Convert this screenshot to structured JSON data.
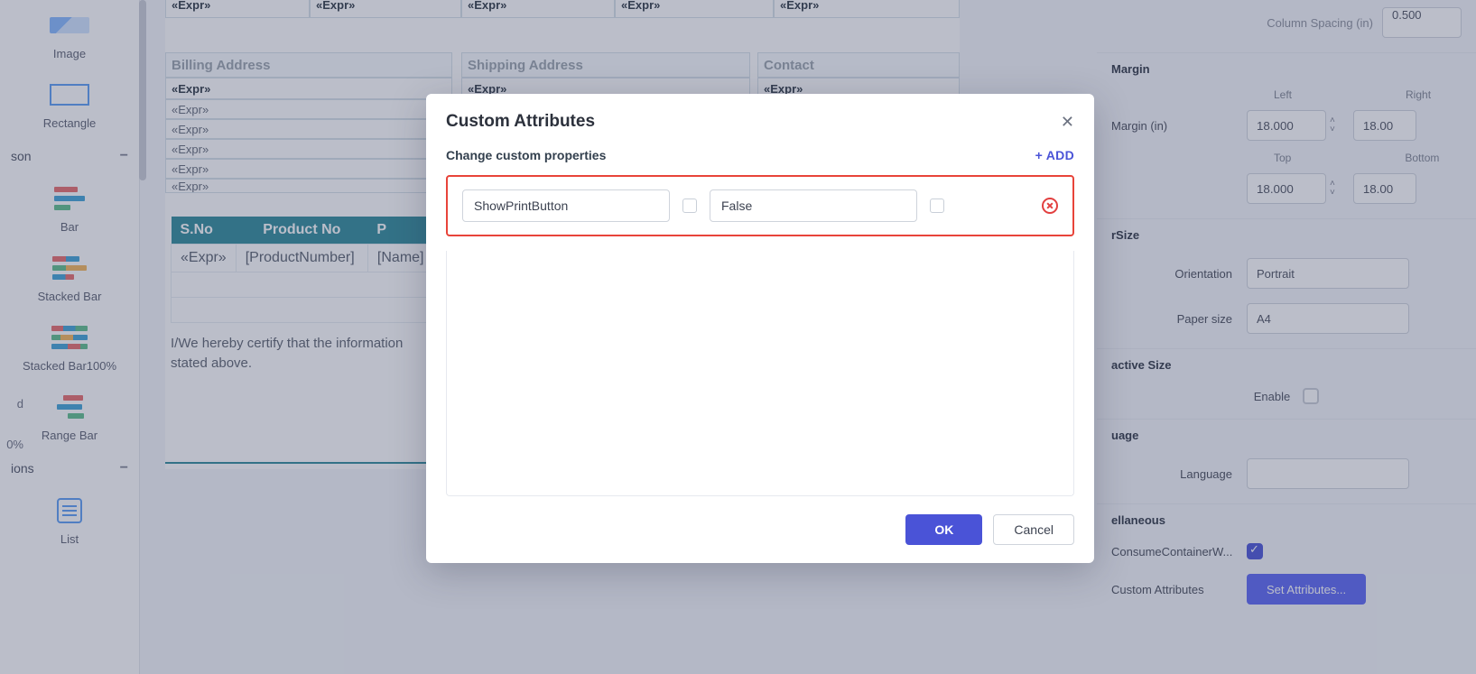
{
  "toolbox": {
    "items": [
      {
        "label": "Image"
      },
      {
        "label": "Rectangle"
      }
    ],
    "section1": "son",
    "chart_items": [
      {
        "label": "Bar"
      },
      {
        "label": "Stacked Bar"
      },
      {
        "label": "Stacked Bar100%"
      },
      {
        "label": "Range Bar"
      }
    ],
    "section2": "ions",
    "list_label": "List",
    "edge_text1": "d",
    "edge_text2": "0%"
  },
  "canvas": {
    "top_expr": "«Expr»",
    "billing_header": "Billing Address",
    "shipping_header": "Shipping Address",
    "contact_header": "Contact",
    "expr_lines": [
      "«Expr»",
      "«Expr»",
      "«Expr»",
      "«Expr»",
      "«Expr»",
      "«Expr»"
    ],
    "table": {
      "headers": [
        "S.No",
        "Product No",
        "P"
      ],
      "row": [
        "«Expr»",
        "[ProductNumber]",
        "[Name]"
      ]
    },
    "cert_text": "I/We hereby certify that the information\nstated above."
  },
  "props": {
    "col_spacing_label": "Column Spacing (in)",
    "col_spacing_val": "0.500",
    "margin_section": "Margin",
    "margin_in_label": "Margin (in)",
    "left_label": "Left",
    "right_label": "Right",
    "top_label": "Top",
    "bottom_label": "Bottom",
    "m_left": "18.000",
    "m_right": "18.00",
    "m_top": "18.000",
    "m_bottom": "18.00",
    "paper_section": "rSize",
    "orientation_label": "Orientation",
    "orientation_val": "Portrait",
    "papersize_label": "Paper size",
    "papersize_val": "A4",
    "interactive_section": "active Size",
    "enable_label": "Enable",
    "lang_section": "uage",
    "lang_label": "Language",
    "misc_section": "ellaneous",
    "consume_label": "ConsumeContainerW...",
    "custom_attr_label": "Custom Attributes",
    "set_attr_btn": "Set Attributes..."
  },
  "modal": {
    "title": "Custom Attributes",
    "subtitle": "Change custom properties",
    "add": "+ ADD",
    "row": {
      "key": "ShowPrintButton",
      "value": "False"
    },
    "ok": "OK",
    "cancel": "Cancel"
  }
}
